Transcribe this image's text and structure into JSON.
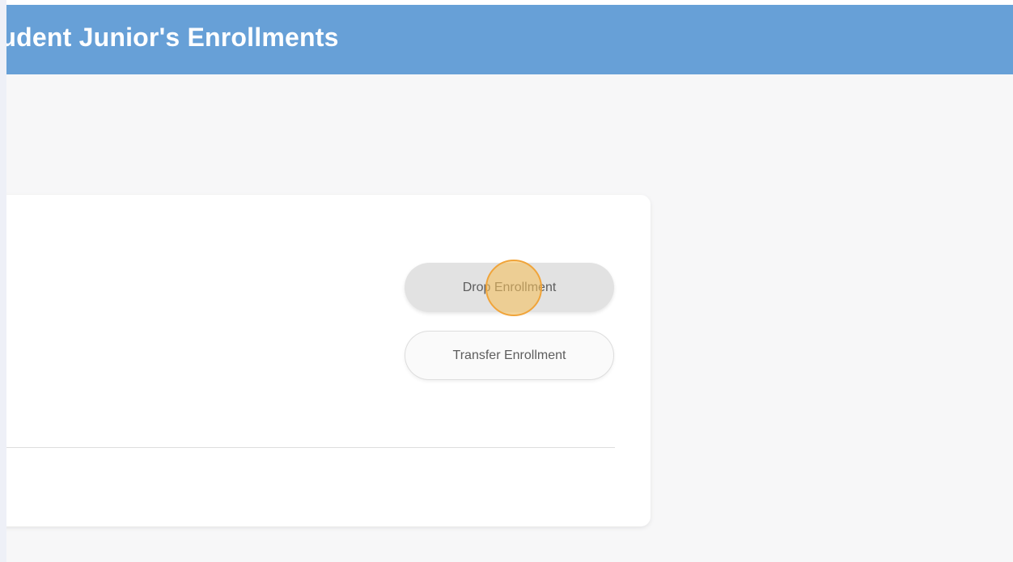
{
  "header": {
    "title": "Student Junior's Enrollments"
  },
  "card": {
    "drop_button_label": "Drop Enrollment",
    "transfer_button_label": "Transfer Enrollment"
  },
  "colors": {
    "header_bg": "#67a0d7",
    "page_bg": "#f7f7f8",
    "click_indicator": "#f4c05c"
  }
}
